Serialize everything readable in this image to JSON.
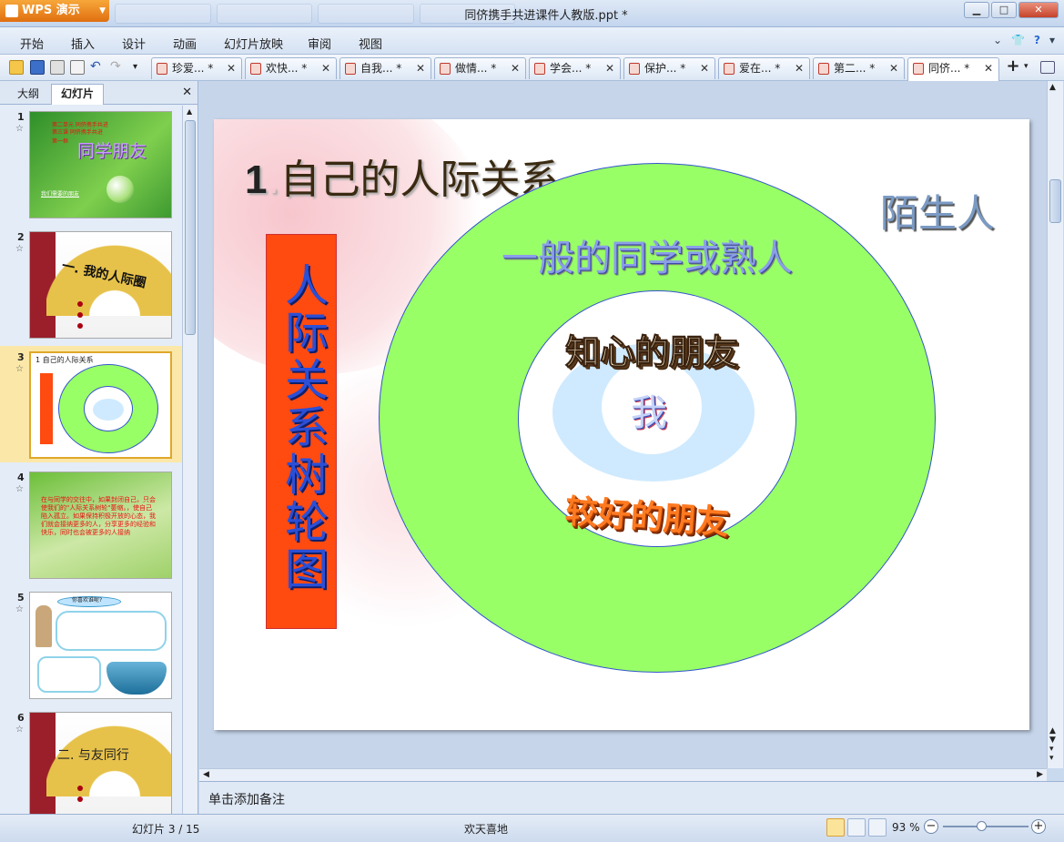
{
  "window": {
    "app_button": "WPS 演示",
    "title": "同侪携手共进课件人教版.ppt *"
  },
  "menu": [
    "开始",
    "插入",
    "设计",
    "动画",
    "幻灯片放映",
    "审阅",
    "视图"
  ],
  "doc_tabs": [
    {
      "label": "珍爱... *"
    },
    {
      "label": "欢快... *"
    },
    {
      "label": "自我... *"
    },
    {
      "label": "做情... *"
    },
    {
      "label": "学会... *"
    },
    {
      "label": "保护... *"
    },
    {
      "label": "爱在... *"
    },
    {
      "label": "第二... *"
    },
    {
      "label": "同侪... *",
      "active": true
    }
  ],
  "sidebar": {
    "tab_outline": "大纲",
    "tab_slides": "幻灯片",
    "slides": [
      {
        "num": "1",
        "theme": "green",
        "lines": [
          "第二单元 同侪携手共进",
          "第三课 同侪携手共进",
          "第一框"
        ],
        "big": "同学朋友",
        "foot": "我们需要的朋友"
      },
      {
        "num": "2",
        "theme": "fan",
        "big": "一. 我的人际圈"
      },
      {
        "num": "3",
        "theme": "current",
        "title": "1 自己的人际关系",
        "selected": true
      },
      {
        "num": "4",
        "theme": "green2",
        "body": "在与同学的交往中，如果封闭自己，只会使我们的\"人际关系树轮\"萎缩。，使自己陷入孤立。如果保持积极开放的心态，我们就会接纳更多的人，分享更多的经验和快乐，同时也会被更多的人接纳"
      },
      {
        "num": "5",
        "theme": "cartoon",
        "bubble": "你喜欢谁呢?"
      },
      {
        "num": "6",
        "theme": "fan",
        "big": "二. 与友同行"
      }
    ]
  },
  "slide": {
    "title_num": "1",
    "title_dot": ".",
    "title_text": "自己的人际关系",
    "vertical_label": "人际关系树轮图",
    "stranger": "陌生人",
    "general": "一般的同学或熟人",
    "close_friend": "知心的朋友",
    "me": "我",
    "good_friend": "较好的朋友"
  },
  "notes_placeholder": "单击添加备注",
  "status": {
    "slide_indicator": "幻灯片 3 / 15",
    "theme": "欢天喜地",
    "zoom": "93 %"
  }
}
